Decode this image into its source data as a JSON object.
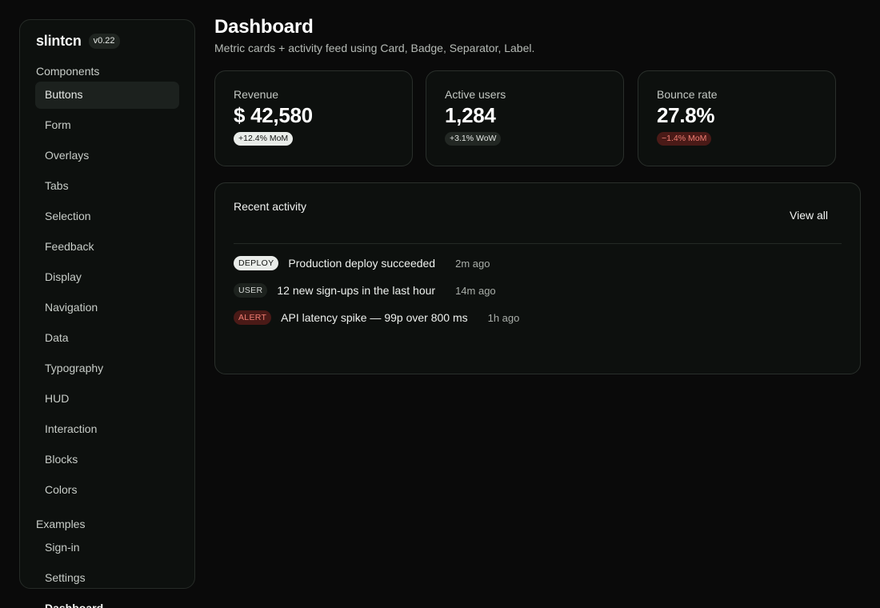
{
  "sidebar": {
    "brand": "slintcn",
    "version": "v0.22",
    "sections": {
      "components_label": "Components",
      "examples_label": "Examples"
    },
    "component_items": [
      "Buttons",
      "Form",
      "Overlays",
      "Tabs",
      "Selection",
      "Feedback",
      "Display",
      "Navigation",
      "Data",
      "Typography",
      "HUD",
      "Interaction",
      "Blocks",
      "Colors"
    ],
    "example_items": [
      "Sign-in",
      "Settings",
      "Dashboard"
    ],
    "active_item": "Buttons"
  },
  "header": {
    "title": "Dashboard",
    "subtitle": "Metric cards + activity feed using Card, Badge, Separator, Label."
  },
  "metrics": [
    {
      "label": "Revenue",
      "value": "$ 42,580",
      "badge": "+12.4% MoM",
      "badge_style": "light"
    },
    {
      "label": "Active users",
      "value": "1,284",
      "badge": "+3.1% WoW",
      "badge_style": "dark"
    },
    {
      "label": "Bounce rate",
      "value": "27.8%",
      "badge": "−1.4% MoM",
      "badge_style": "danger"
    }
  ],
  "activity": {
    "title": "Recent activity",
    "view_all": "View all",
    "items": [
      {
        "tag": "DEPLOY",
        "text": "Production deploy succeeded",
        "time": "2m ago"
      },
      {
        "tag": "USER",
        "text": "12 new sign-ups in the last hour",
        "time": "14m ago"
      },
      {
        "tag": "ALERT",
        "text": "API latency spike — 99p over 800 ms",
        "time": "1h ago"
      }
    ]
  },
  "colors": {
    "background": "#0a0a0a",
    "card": "#0d100e",
    "border": "#2a2f2b",
    "danger": "#f07d72",
    "danger_bg": "#4a1a17"
  }
}
